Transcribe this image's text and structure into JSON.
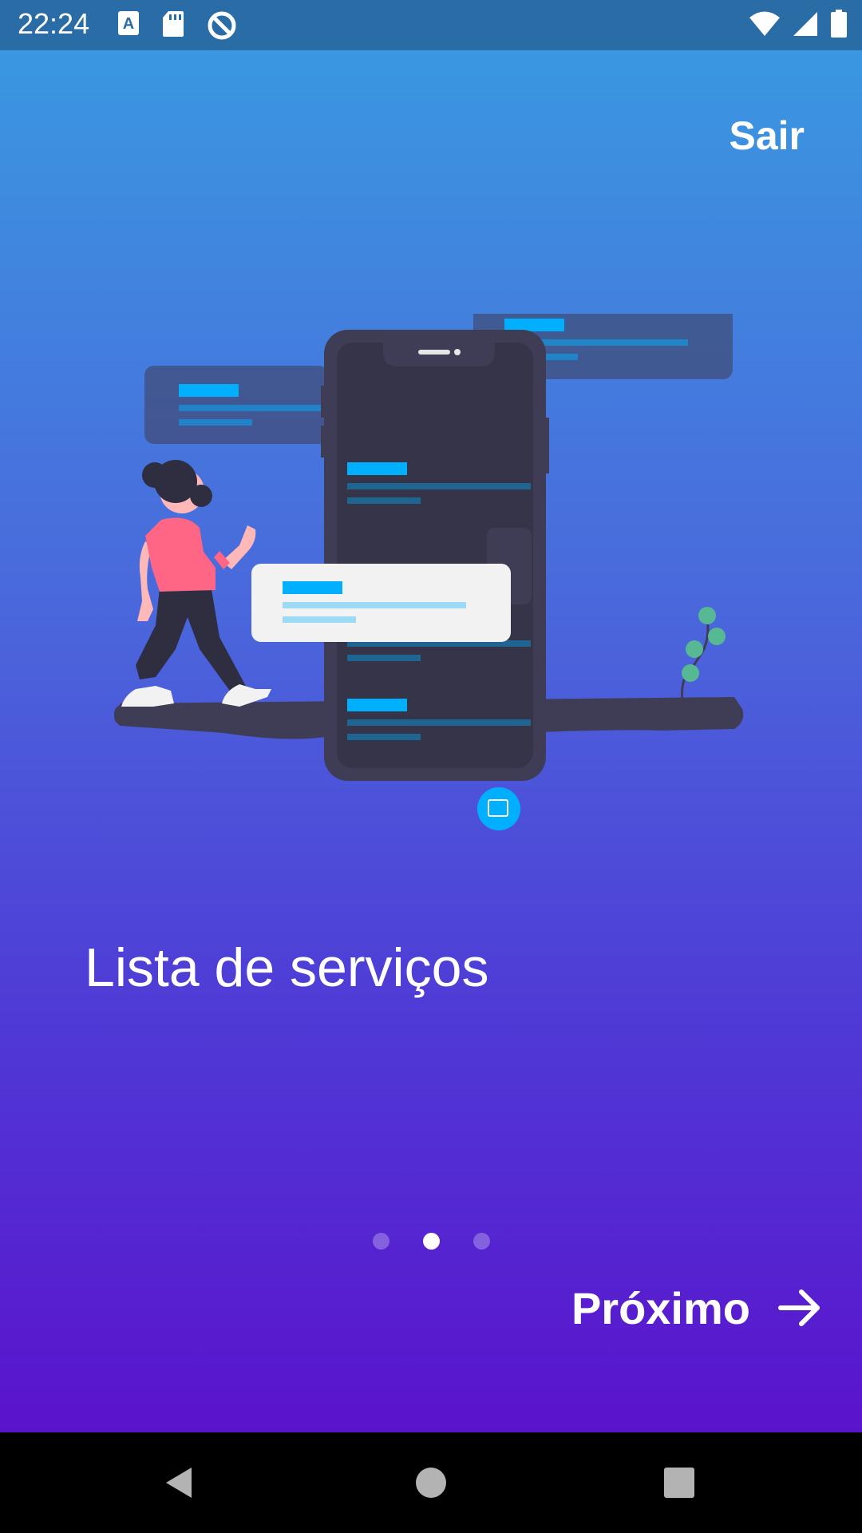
{
  "status_bar": {
    "time": "22:24",
    "left_icons": [
      "font-icon",
      "sd-card-icon",
      "data-saver-icon"
    ],
    "right_icons": [
      "wifi-icon",
      "signal-icon",
      "battery-icon"
    ]
  },
  "onboarding": {
    "skip_label": "Sair",
    "title": "Lista de serviços",
    "next_label": "Próximo",
    "next_icon": "arrow-right-icon",
    "page_count": 3,
    "current_page": 2
  },
  "navigation_bar": {
    "buttons": [
      "back-icon",
      "home-icon",
      "recents-icon"
    ]
  },
  "colors": {
    "status_bar": "#2a6ca5",
    "gradient_top": "#3a97e0",
    "gradient_bottom": "#5a13cc",
    "accent_blue": "#00b0ff",
    "phone_dark": "#3f3d56",
    "shirt_pink": "#ff6584"
  }
}
